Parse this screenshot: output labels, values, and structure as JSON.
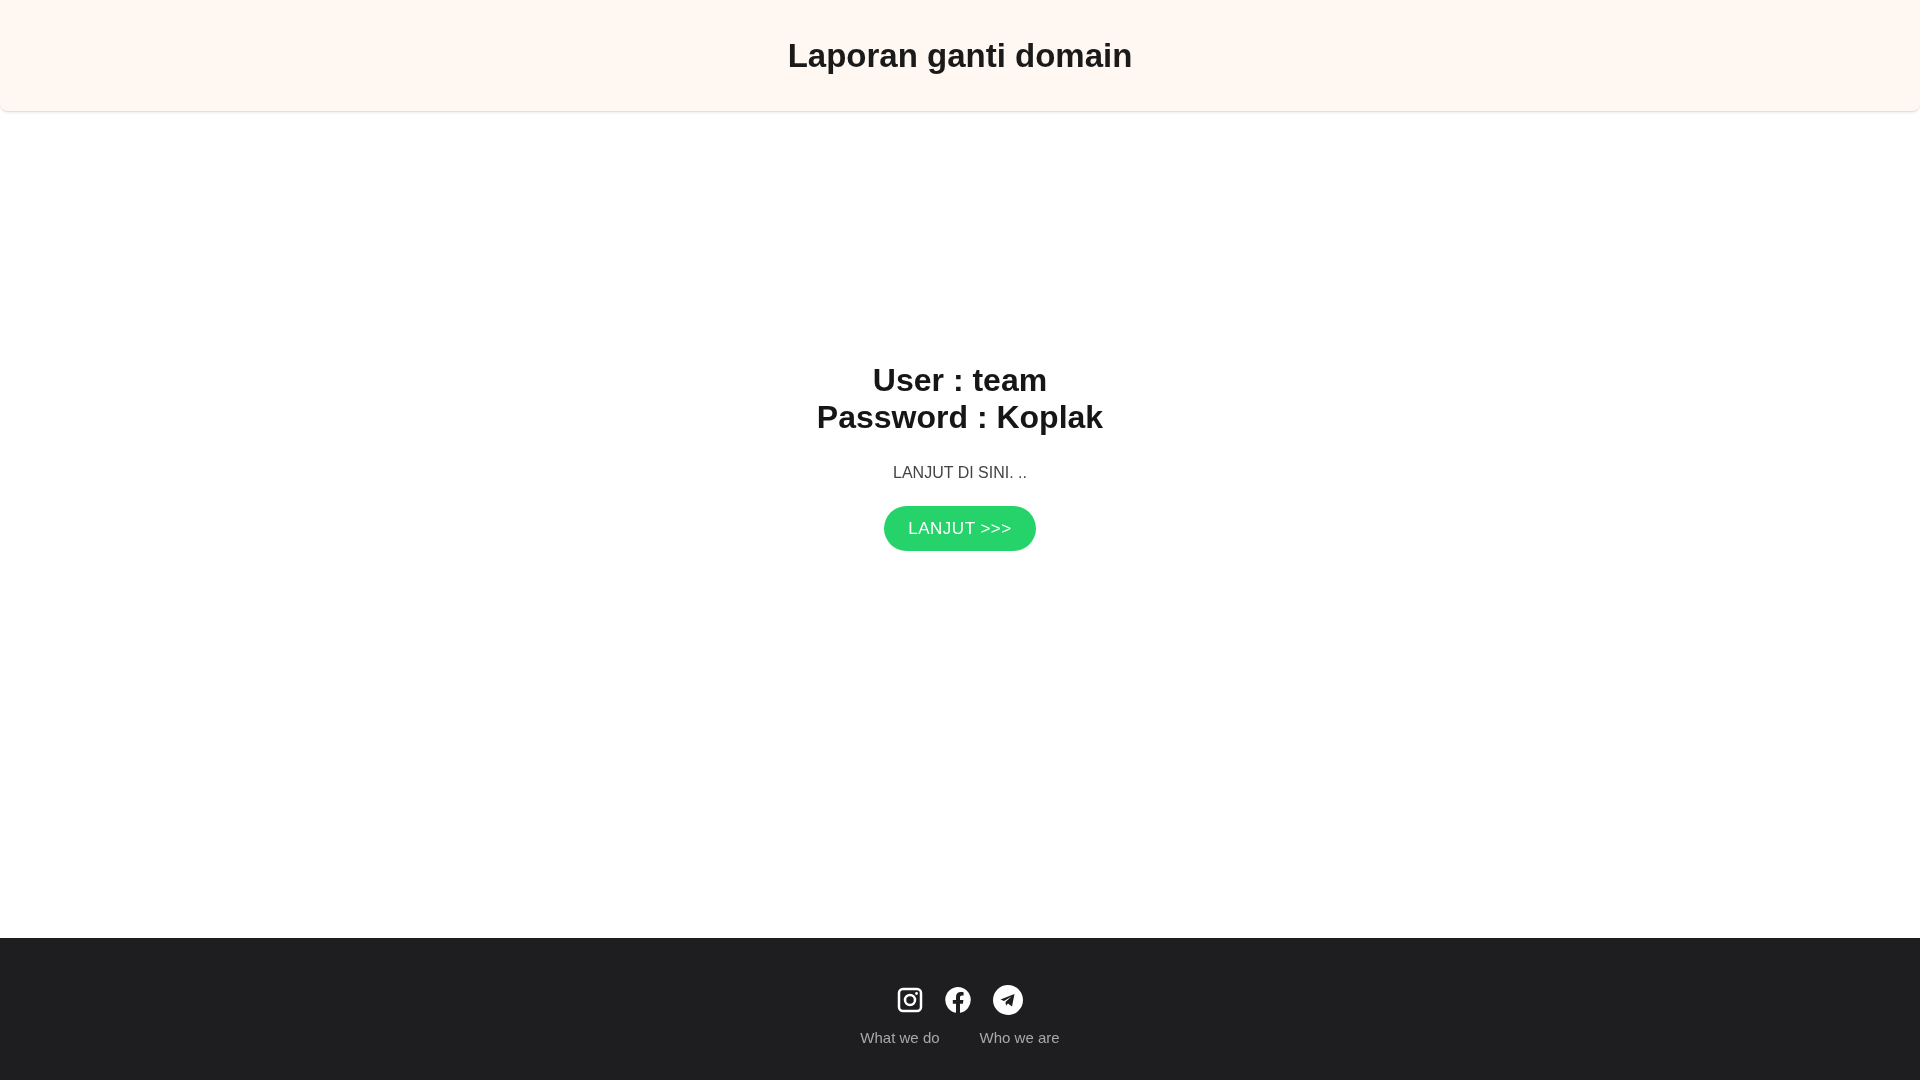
{
  "header": {
    "title": "Laporan ganti domain"
  },
  "main": {
    "lines": [
      "User : team",
      "Password : Koplak"
    ],
    "note": "LANJUT DI SINI. ..",
    "button": "LANJUT >>>"
  },
  "footer": {
    "social": [
      {
        "kind": "instagram"
      },
      {
        "kind": "facebook"
      },
      {
        "kind": "telegram"
      }
    ],
    "links": [
      "What we do",
      "Who we are"
    ]
  }
}
